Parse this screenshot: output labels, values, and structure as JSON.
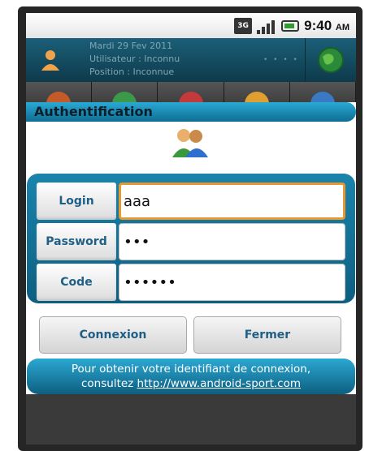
{
  "statusbar": {
    "network_badge": "3G",
    "time": "9:40",
    "ampm": "AM",
    "icons": [
      "3g-icon",
      "signal-icon",
      "battery-icon"
    ]
  },
  "header": {
    "date": "Mardi 29 Fev 2011",
    "user": "Utilisateur : Inconnu",
    "position": "Position : Inconnue"
  },
  "dialog": {
    "title": "Authentification",
    "fields": [
      {
        "label": "Login",
        "value": "aaa"
      },
      {
        "label": "Password",
        "value": "•••"
      },
      {
        "label": "Code",
        "value": "••••••"
      }
    ],
    "buttons": {
      "connect": "Connexion",
      "close": "Fermer"
    },
    "footer": {
      "text_line1": "Pour obtenir votre identifiant de connexion,",
      "text_prefix": "consultez",
      "link": "http://www.android-sport.com"
    }
  },
  "colors": {
    "accent": "#0e6e93",
    "focus_border": "#e8982f",
    "label_text": "#1f5f86"
  }
}
